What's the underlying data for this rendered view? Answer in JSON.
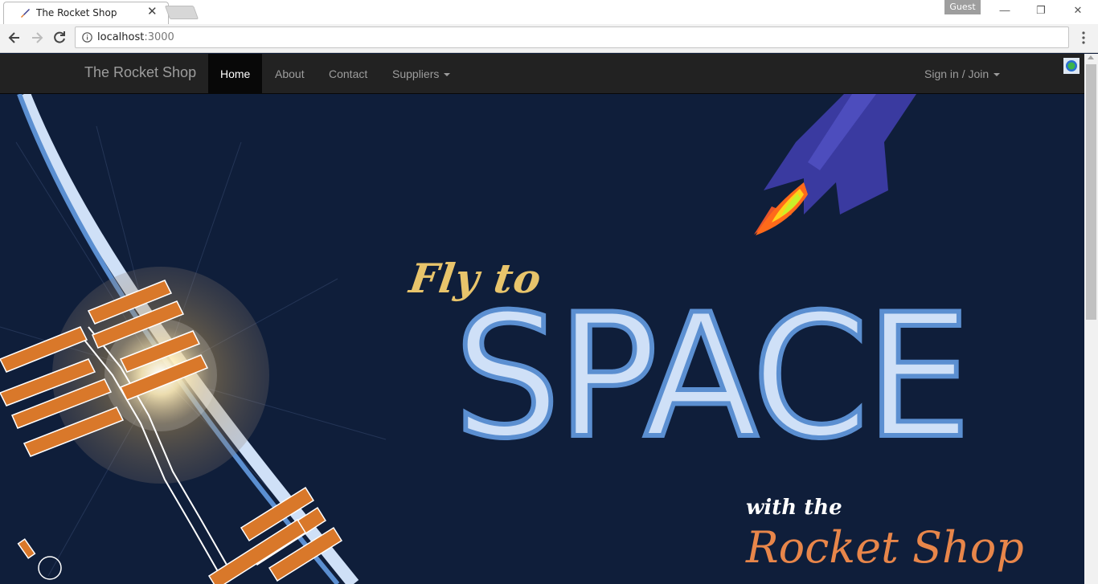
{
  "browser": {
    "tab": {
      "title": "The Rocket Shop"
    },
    "profile_label": "Guest",
    "url_host": "localhost",
    "url_port": ":3000"
  },
  "navbar": {
    "brand": "The Rocket Shop",
    "items": [
      {
        "label": "Home",
        "active": true
      },
      {
        "label": "About",
        "active": false
      },
      {
        "label": "Contact",
        "active": false
      },
      {
        "label": "Suppliers",
        "active": false,
        "dropdown": true
      }
    ],
    "signin_label": "Sign in / Join"
  },
  "hero": {
    "line1": "Fly to",
    "line2": "SPACE",
    "line3": "with the",
    "line4": "Rocket Shop"
  },
  "colors": {
    "navbar_bg": "#222222",
    "hero_bg": "#0f1e3a",
    "fly_to": "#e8c46b",
    "space_fill": "#cfe0f7",
    "rocket_shop": "#e8864a"
  }
}
